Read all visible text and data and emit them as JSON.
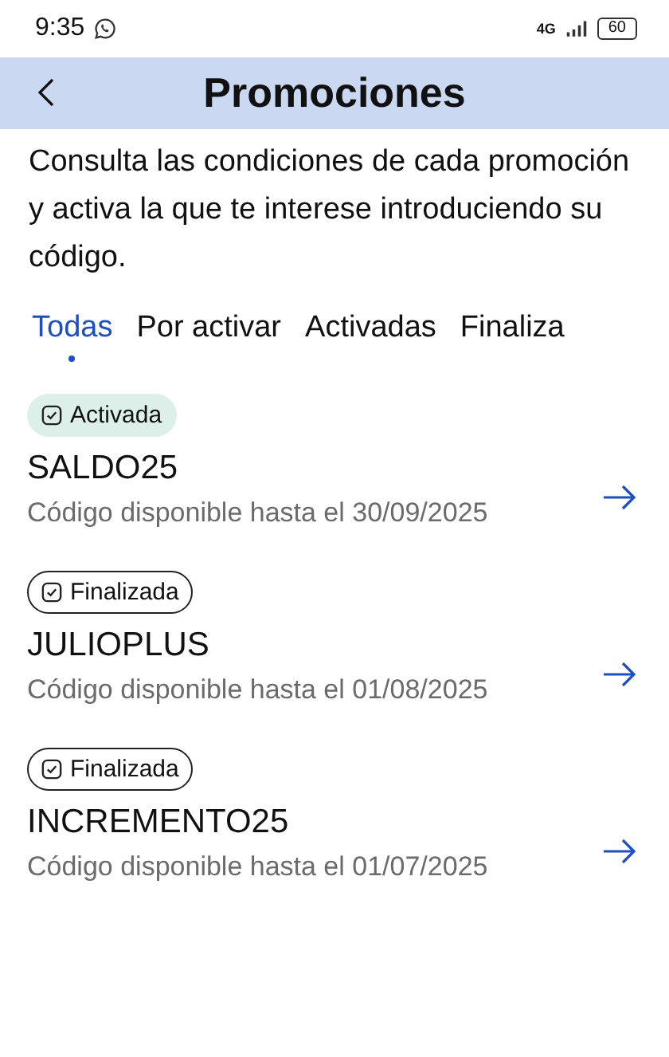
{
  "status_bar": {
    "time": "9:35",
    "network": "4G",
    "battery": "60"
  },
  "header": {
    "title": "Promociones"
  },
  "intro": "Consulta las condiciones de cada promoción y activa la que te interese introduciendo su código.",
  "tabs": [
    {
      "label": "Todas",
      "selected": true
    },
    {
      "label": "Por activar",
      "selected": false
    },
    {
      "label": "Activadas",
      "selected": false
    },
    {
      "label": "Finaliza",
      "selected": false
    }
  ],
  "promotions": [
    {
      "badge": {
        "kind": "active",
        "label": "Activada"
      },
      "code": "SALDO25",
      "availability": "Código disponible hasta el 30/09/2025"
    },
    {
      "badge": {
        "kind": "ended",
        "label": "Finalizada"
      },
      "code": "JULIOPLUS",
      "availability": "Código disponible hasta el 01/08/2025"
    },
    {
      "badge": {
        "kind": "ended",
        "label": "Finalizada"
      },
      "code": "INCREMENTO25",
      "availability": "Código disponible hasta el 01/07/2025"
    }
  ]
}
